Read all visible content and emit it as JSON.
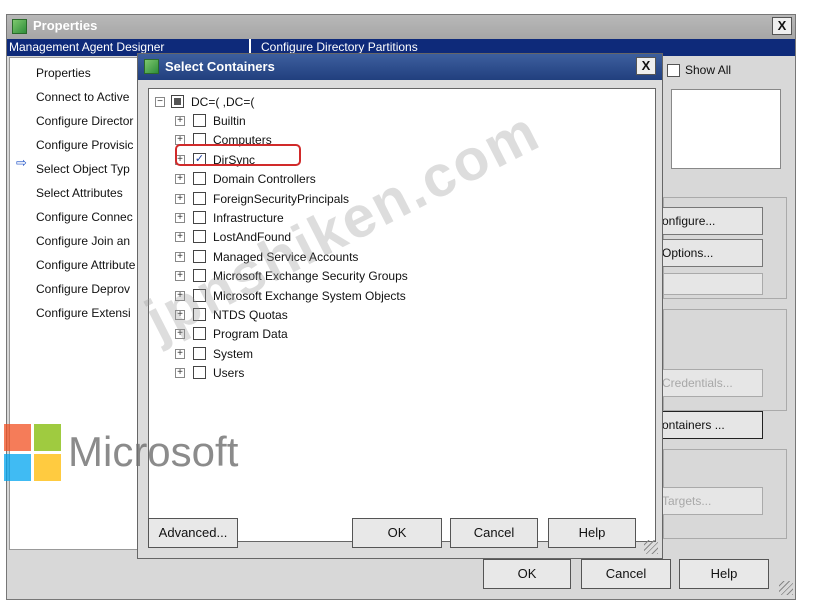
{
  "properties_window": {
    "title": "Properties",
    "close_glyph": "X",
    "left_header": "Management Agent Designer",
    "right_header": "Configure Directory Partitions",
    "nav_items": [
      {
        "label": "Properties"
      },
      {
        "label": "Connect to Active"
      },
      {
        "label": "Configure Director",
        "selected": true
      },
      {
        "label": "Configure Provisic"
      },
      {
        "label": "Select Object Typ"
      },
      {
        "label": "Select Attributes"
      },
      {
        "label": "Configure Connec"
      },
      {
        "label": "Configure Join an"
      },
      {
        "label": "Configure Attribute"
      },
      {
        "label": "Configure Deprov"
      },
      {
        "label": "Configure Extensi"
      }
    ],
    "selected_arrow_glyph": "⇨",
    "show_all_label": "Show All",
    "right_buttons": {
      "configure": "onfigure...",
      "options": "Options...",
      "credentials": "Credentials...",
      "containers": "ontainers ...",
      "targets": "Targets..."
    },
    "ok": "OK",
    "cancel": "Cancel",
    "help": "Help"
  },
  "select_containers": {
    "title": "Select Containers",
    "close_glyph": "X",
    "root_label": "DC=( ,DC=(",
    "items": [
      {
        "label": "Builtin",
        "checked": false
      },
      {
        "label": "Computers",
        "checked": false
      },
      {
        "label": "DirSync",
        "checked": true
      },
      {
        "label": "Domain Controllers",
        "checked": false
      },
      {
        "label": "ForeignSecurityPrincipals",
        "checked": false
      },
      {
        "label": "Infrastructure",
        "checked": false
      },
      {
        "label": "LostAndFound",
        "checked": false
      },
      {
        "label": "Managed Service Accounts",
        "checked": false
      },
      {
        "label": "Microsoft Exchange Security Groups",
        "checked": false
      },
      {
        "label": "Microsoft Exchange System Objects",
        "checked": false
      },
      {
        "label": "NTDS Quotas",
        "checked": false
      },
      {
        "label": "Program Data",
        "checked": false
      },
      {
        "label": "System",
        "checked": false
      },
      {
        "label": "Users",
        "checked": false
      }
    ],
    "expander_glyph": "+",
    "collapse_glyph": "−",
    "check_glyph": "✓",
    "advanced": "Advanced...",
    "ok": "OK",
    "cancel": "Cancel",
    "help": "Help"
  },
  "overlay": {
    "brand_logo_text": "Microsoft",
    "watermark_text": "jpnshiken.com"
  },
  "colors": {
    "title_bar_blue": "#213f7e",
    "header_navy": "#0e2a7a",
    "highlight_red": "#d12a2a"
  }
}
